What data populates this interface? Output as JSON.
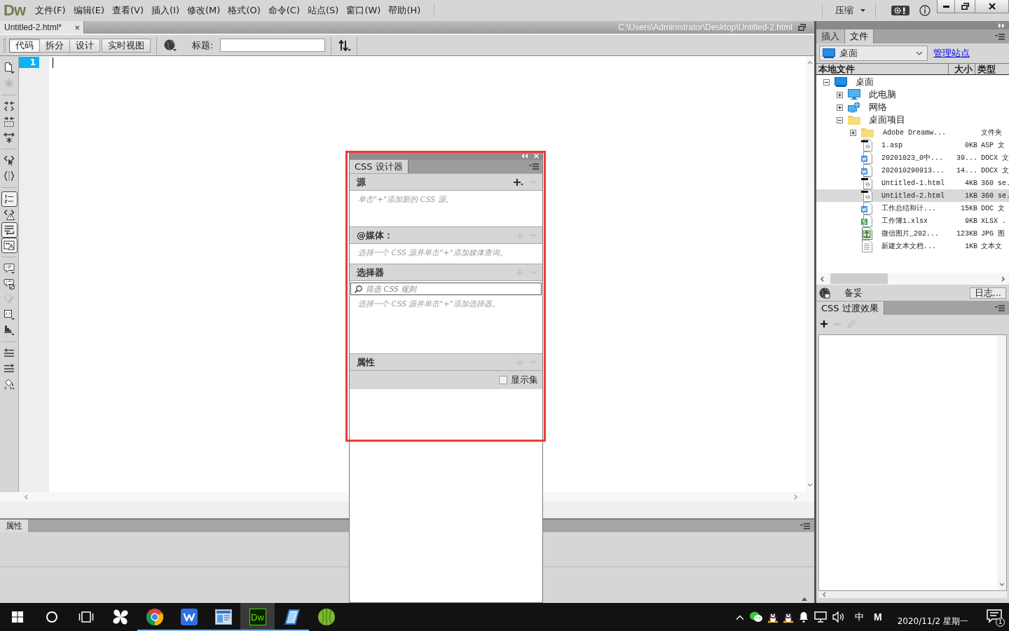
{
  "menubar": {
    "logo": "Dw",
    "items": [
      "文件(F)",
      "编辑(E)",
      "查看(V)",
      "插入(I)",
      "修改(M)",
      "格式(O)",
      "命令(C)",
      "站点(S)",
      "窗口(W)",
      "帮助(H)"
    ],
    "workspace": "压缩"
  },
  "document": {
    "tab": "Untitled-2.html*",
    "close": "×",
    "path": "C:\\Users\\Administrator\\Desktop\\Untitled-2.html",
    "views": [
      {
        "label": "代码",
        "selected": true
      },
      {
        "label": "拆分",
        "selected": false
      },
      {
        "label": "设计",
        "selected": false
      },
      {
        "label": "实时视图",
        "selected": false
      }
    ],
    "title_label": "标题:",
    "line_numbers": [
      "1"
    ]
  },
  "coding_toolbar": [
    [
      {
        "on": false,
        "disabled": false
      },
      {
        "on": false,
        "disabled": true
      }
    ],
    [
      {
        "on": false,
        "disabled": false
      },
      {
        "on": false,
        "disabled": false
      },
      {
        "on": false,
        "disabled": false
      }
    ],
    [
      {
        "on": false,
        "disabled": false
      },
      {
        "on": false,
        "disabled": false
      }
    ],
    [
      {
        "on": true,
        "disabled": false
      },
      {
        "on": false,
        "disabled": false
      },
      {
        "on": true,
        "disabled": false
      },
      {
        "on": true,
        "disabled": false
      }
    ],
    [
      {
        "on": false,
        "disabled": false
      },
      {
        "on": false,
        "disabled": false
      },
      {
        "on": false,
        "disabled": true
      },
      {
        "on": false,
        "disabled": false
      },
      {
        "on": false,
        "disabled": false
      }
    ],
    [
      {
        "on": false,
        "disabled": false
      },
      {
        "on": false,
        "disabled": false
      },
      {
        "on": false,
        "disabled": false
      }
    ]
  ],
  "properties_panel": {
    "tab": "属性"
  },
  "files_panel": {
    "tabs": [
      {
        "label": "插入",
        "selected": false
      },
      {
        "label": "文件",
        "selected": true
      }
    ],
    "site": "桌面",
    "manage_link": "管理站点",
    "columns": [
      "本地文件",
      "大小",
      "类型"
    ],
    "tree": [
      {
        "kind": "desktop",
        "name": "桌面",
        "expanded": true,
        "selected": false,
        "children": [
          {
            "kind": "computer",
            "name": "此电脑",
            "expanded": false,
            "selected": false
          },
          {
            "kind": "network",
            "name": "网络",
            "expanded": false,
            "selected": false
          },
          {
            "kind": "folder",
            "name": "桌面项目",
            "expanded": true,
            "selected": false,
            "children": [
              {
                "kind": "folder",
                "name": "Adobe Dreamw...",
                "type": "文件夹",
                "expanded": false,
                "selected": false
              },
              {
                "kind": "html",
                "name": "1.asp",
                "size": "0KB",
                "type": "ASP 文",
                "selected": false
              },
              {
                "kind": "word",
                "name": "20201023_0中...",
                "size": "39...",
                "type": "DOCX 文",
                "selected": false
              },
              {
                "kind": "word",
                "name": "202010290913...",
                "size": "14...",
                "type": "DOCX 文",
                "selected": false
              },
              {
                "kind": "html",
                "name": "Untitled-1.html",
                "size": "4KB",
                "type": "360 se.",
                "selected": false
              },
              {
                "kind": "html",
                "name": "Untitled-2.html",
                "size": "1KB",
                "type": "360 se.",
                "selected": true
              },
              {
                "kind": "word",
                "name": "工作总结和计...",
                "size": "15KB",
                "type": "DOC 文",
                "selected": false
              },
              {
                "kind": "excel",
                "name": "工作簿1.xlsx",
                "size": "9KB",
                "type": "XLSX .",
                "selected": false
              },
              {
                "kind": "image",
                "name": "微信图片_202...",
                "size": "123KB",
                "type": "JPG 图",
                "selected": false
              },
              {
                "kind": "text",
                "name": "新建文本文档...",
                "size": "1KB",
                "type": "文本文",
                "selected": false
              }
            ]
          }
        ]
      }
    ],
    "status": "备妥",
    "log_button": "日志..."
  },
  "transitions_panel": {
    "tab": "CSS 过渡效果",
    "add_disabled": false,
    "remove_disabled": true,
    "edit_disabled": true
  },
  "css_designer": {
    "tab": "CSS 设计器",
    "sections": [
      {
        "title": "源",
        "add_disabled": false,
        "remove_disabled": true,
        "hint": "单击\"+\"添加新的 CSS 源。"
      },
      {
        "title": "@媒体：",
        "add_disabled": true,
        "remove_disabled": true,
        "hint": "选择一个 CSS 源并单击\"+\"添加媒体查询。"
      },
      {
        "title": "选择器",
        "add_disabled": true,
        "remove_disabled": true,
        "filter_placeholder": "筛选 CSS 规则",
        "hint": "选择一个 CSS 源并单击\"+\"添加选择器。"
      },
      {
        "title": "属性",
        "add_disabled": true,
        "remove_disabled": true,
        "show_set": {
          "label": "显示集",
          "checked": false
        }
      }
    ]
  },
  "taskbar": {
    "apps": [
      {
        "kind": "pinwheel",
        "running": false,
        "active": false
      },
      {
        "kind": "browser",
        "running": true,
        "active": false
      },
      {
        "kind": "writer",
        "running": true,
        "active": false
      },
      {
        "kind": "panel",
        "running": true,
        "active": false
      },
      {
        "kind": "dreamweaver",
        "label": "Dw",
        "running": true,
        "active": true
      },
      {
        "kind": "tablet",
        "running": true,
        "active": false
      },
      {
        "kind": "ball",
        "running": false,
        "active": false
      }
    ],
    "ime": "中",
    "ime_mode": "M",
    "date": "2020/11/2 星期一",
    "notifications": "1"
  }
}
